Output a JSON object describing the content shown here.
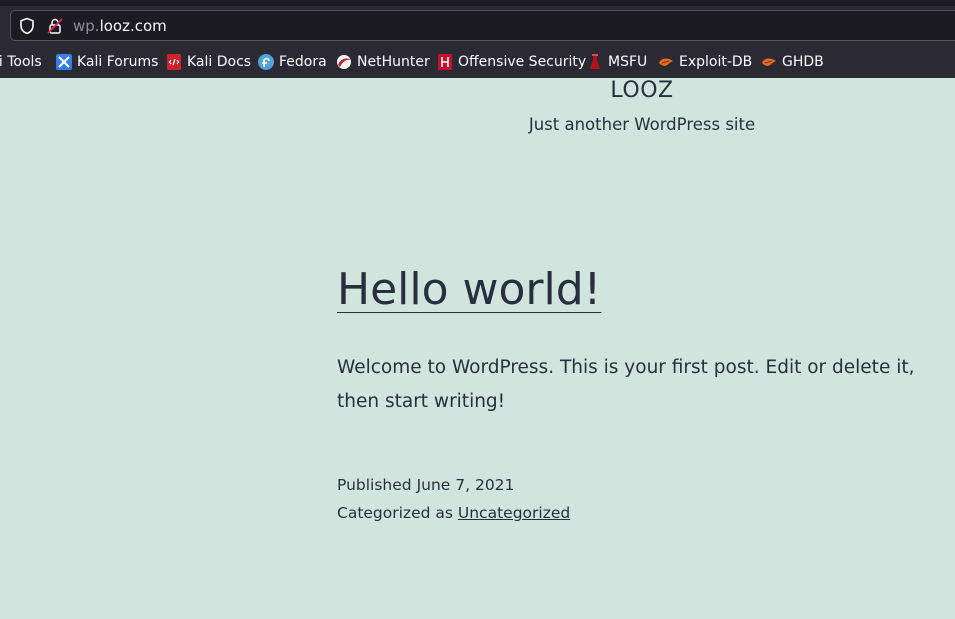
{
  "browser": {
    "url_subdomain": "wp.",
    "url_domain": "looz.com",
    "bookmarks": [
      {
        "label": "li Tools",
        "icon": "kali-tools-icon"
      },
      {
        "label": "Kali Forums",
        "icon": "kali-forums-icon"
      },
      {
        "label": "Kali Docs",
        "icon": "kali-docs-icon"
      },
      {
        "label": "Fedora",
        "icon": "fedora-icon"
      },
      {
        "label": "NetHunter",
        "icon": "nethunter-icon"
      },
      {
        "label": "Offensive Security",
        "icon": "offensive-security-icon"
      },
      {
        "label": "MSFU",
        "icon": "msfu-icon"
      },
      {
        "label": "Exploit-DB",
        "icon": "exploit-db-icon"
      },
      {
        "label": "GHDB",
        "icon": "ghdb-icon"
      }
    ]
  },
  "site": {
    "title": "LOOZ",
    "description": "Just another WordPress site"
  },
  "post": {
    "title": "Hello world!",
    "content": "Welcome to WordPress. This is your first post. Edit or delete it, then start writing!",
    "published_label": "Published",
    "published_date": "June 7, 2021",
    "category_label": "Categorized as",
    "category": "Uncategorized"
  },
  "colors": {
    "page_background": "#d1e4dd",
    "text": "#28303d",
    "chrome_background": "#2b2a33"
  }
}
